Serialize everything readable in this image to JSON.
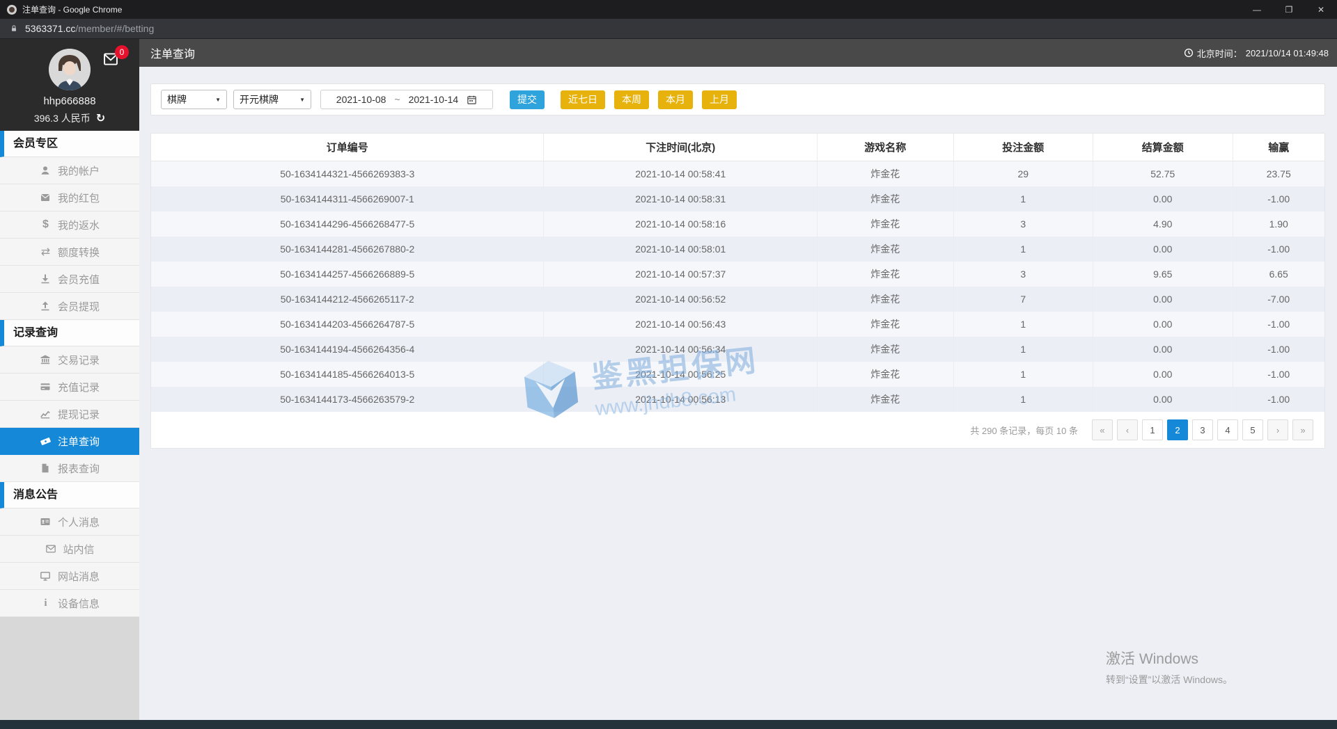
{
  "window": {
    "title": "注单查询 - Google Chrome",
    "url_host": "5363371.cc",
    "url_path": "/member/#/betting",
    "controls": {
      "minimize": "—",
      "restore": "❐",
      "close": "✕"
    }
  },
  "user": {
    "name": "hhp666888",
    "balance": "396.3 人民币",
    "mail_badge": "0"
  },
  "sidebar": {
    "sections": [
      {
        "title": "会员专区",
        "items": [
          {
            "icon": "user",
            "label": "我的帐户",
            "active": false
          },
          {
            "icon": "red-packet",
            "label": "我的红包",
            "active": false
          },
          {
            "icon": "dollar",
            "label": "我的返水",
            "active": false
          },
          {
            "icon": "transfer",
            "label": "额度转换",
            "active": false
          },
          {
            "icon": "deposit",
            "label": "会员充值",
            "active": false
          },
          {
            "icon": "withdraw",
            "label": "会员提现",
            "active": false
          }
        ]
      },
      {
        "title": "记录查询",
        "items": [
          {
            "icon": "bank",
            "label": "交易记录",
            "active": false
          },
          {
            "icon": "credit-card",
            "label": "充值记录",
            "active": false
          },
          {
            "icon": "chart-line",
            "label": "提现记录",
            "active": false
          },
          {
            "icon": "ticket",
            "label": "注单查询",
            "active": true
          },
          {
            "icon": "report",
            "label": "报表查询",
            "active": false
          }
        ]
      },
      {
        "title": "消息公告",
        "items": [
          {
            "icon": "id-card",
            "label": "个人消息",
            "active": false
          },
          {
            "icon": "mail-outline",
            "label": "站内信",
            "active": false
          },
          {
            "icon": "monitor",
            "label": "网站消息",
            "active": false
          },
          {
            "icon": "info",
            "label": "设备信息",
            "active": false
          }
        ]
      }
    ]
  },
  "header": {
    "title": "注单查询",
    "time_label": "北京时间：",
    "time_value": "2021/10/14 01:49:48"
  },
  "filters": {
    "category": "棋牌",
    "provider": "开元棋牌",
    "date_from": "2021-10-08",
    "date_separator": "~",
    "date_to": "2021-10-14",
    "submit_label": "提交",
    "quick_buttons": [
      "近七日",
      "本周",
      "本月",
      "上月"
    ]
  },
  "table": {
    "columns": [
      "订单编号",
      "下注时间(北京)",
      "游戏名称",
      "投注金额",
      "结算金额",
      "输赢"
    ],
    "rows": [
      [
        "50-1634144321-4566269383-3",
        "2021-10-14 00:58:41",
        "炸金花",
        "29",
        "52.75",
        "23.75"
      ],
      [
        "50-1634144311-4566269007-1",
        "2021-10-14 00:58:31",
        "炸金花",
        "1",
        "0.00",
        "-1.00"
      ],
      [
        "50-1634144296-4566268477-5",
        "2021-10-14 00:58:16",
        "炸金花",
        "3",
        "4.90",
        "1.90"
      ],
      [
        "50-1634144281-4566267880-2",
        "2021-10-14 00:58:01",
        "炸金花",
        "1",
        "0.00",
        "-1.00"
      ],
      [
        "50-1634144257-4566266889-5",
        "2021-10-14 00:57:37",
        "炸金花",
        "3",
        "9.65",
        "6.65"
      ],
      [
        "50-1634144212-4566265117-2",
        "2021-10-14 00:56:52",
        "炸金花",
        "7",
        "0.00",
        "-7.00"
      ],
      [
        "50-1634144203-4566264787-5",
        "2021-10-14 00:56:43",
        "炸金花",
        "1",
        "0.00",
        "-1.00"
      ],
      [
        "50-1634144194-4566264356-4",
        "2021-10-14 00:56:34",
        "炸金花",
        "1",
        "0.00",
        "-1.00"
      ],
      [
        "50-1634144185-4566264013-5",
        "2021-10-14 00:56:25",
        "炸金花",
        "1",
        "0.00",
        "-1.00"
      ],
      [
        "50-1634144173-4566263579-2",
        "2021-10-14 00:56:13",
        "炸金花",
        "1",
        "0.00",
        "-1.00"
      ]
    ]
  },
  "pagination": {
    "summary": "共 290 条记录，每页 10 条",
    "pages": [
      "«",
      "‹",
      "1",
      "2",
      "3",
      "4",
      "5",
      "›",
      "»"
    ],
    "active_index": 3
  },
  "watermark": {
    "title": "鉴黑担保网",
    "url": "www.jhdb8.com"
  },
  "activation": {
    "line1": "激活 Windows",
    "line2": "转到“设置”以激活 Windows。"
  }
}
